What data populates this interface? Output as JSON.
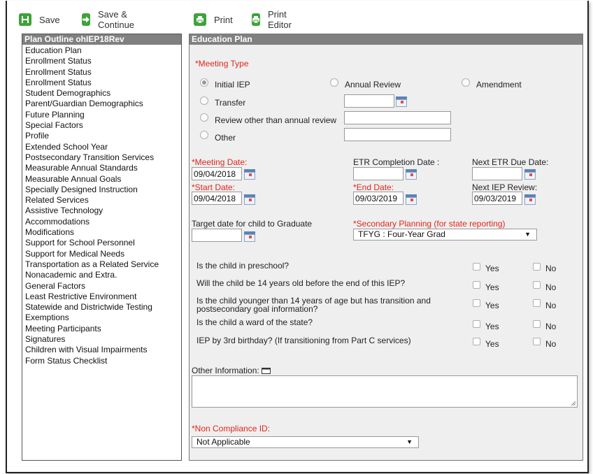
{
  "toolbar": {
    "save": "Save",
    "save_continue": "Save & Continue",
    "print": "Print",
    "print_editor": "Print Editor"
  },
  "outline": {
    "title": "Plan Outline ohIEP18Rev",
    "items": [
      "Education Plan",
      "Enrollment Status",
      "Enrollment Status",
      "Enrollment Status",
      "Student Demographics",
      "Parent/Guardian Demographics",
      "Future Planning",
      "Special Factors",
      "Profile",
      "Extended School Year",
      "Postsecondary Transition Services",
      "Measurable Annual Standards",
      "Measurable Annual Goals",
      "Specially Designed Instruction",
      "Related Services",
      "Assistive Technology",
      "Accommodations",
      "Modifications",
      "Support for School Personnel",
      "Support for Medical Needs",
      "Transportation as a Related Service",
      "Nonacademic and Extra.",
      "General Factors",
      "Least Restrictive Environment",
      "Statewide and Districtwide Testing",
      "Exemptions",
      "Meeting Participants",
      "Signatures",
      "Children with Visual Impairments",
      "Form Status Checklist"
    ]
  },
  "plan": {
    "title": "Education Plan",
    "meeting_type_label": "*Meeting Type",
    "meeting_types": {
      "initial": "Initial IEP",
      "annual": "Annual Review",
      "amendment": "Amendment",
      "transfer": "Transfer",
      "review_other": "Review other than annual review",
      "other": "Other"
    },
    "meeting_date_label": "*Meeting Date:",
    "meeting_date": "09/04/2018",
    "etr_completion_label": "ETR Completion Date :",
    "etr_completion": "",
    "next_etr_label": "Next ETR Due Date:",
    "next_etr": "",
    "start_date_label": "*Start Date:",
    "start_date": "09/04/2018",
    "end_date_label": "*End Date:",
    "end_date": "09/03/2019",
    "next_iep_label": "Next IEP Review:",
    "next_iep": "09/03/2019",
    "target_grad_label": "Target date for child to Graduate",
    "secondary_label": "*Secondary Planning (for state reporting)",
    "secondary_value": "TFYG : Four-Year Grad",
    "questions": [
      {
        "q1": "Is the child in preschool?",
        "q2": ""
      },
      {
        "q1": "Will the child be 14 years old before the end of this IEP?",
        "q2": ""
      },
      {
        "q1": "Is the child younger than 14 years of age but has transition and",
        "q2": "postsecondary goal information?"
      },
      {
        "q1": "Is the child a ward of the state?",
        "q2": ""
      },
      {
        "q1": "IEP by 3rd birthday? (If transitioning from Part C services)",
        "q2": ""
      }
    ],
    "yes": "Yes",
    "no": "No",
    "other_info_label": "Other Information:",
    "non_compliance_label": "*Non Compliance ID:",
    "non_compliance_value": "Not Applicable"
  }
}
